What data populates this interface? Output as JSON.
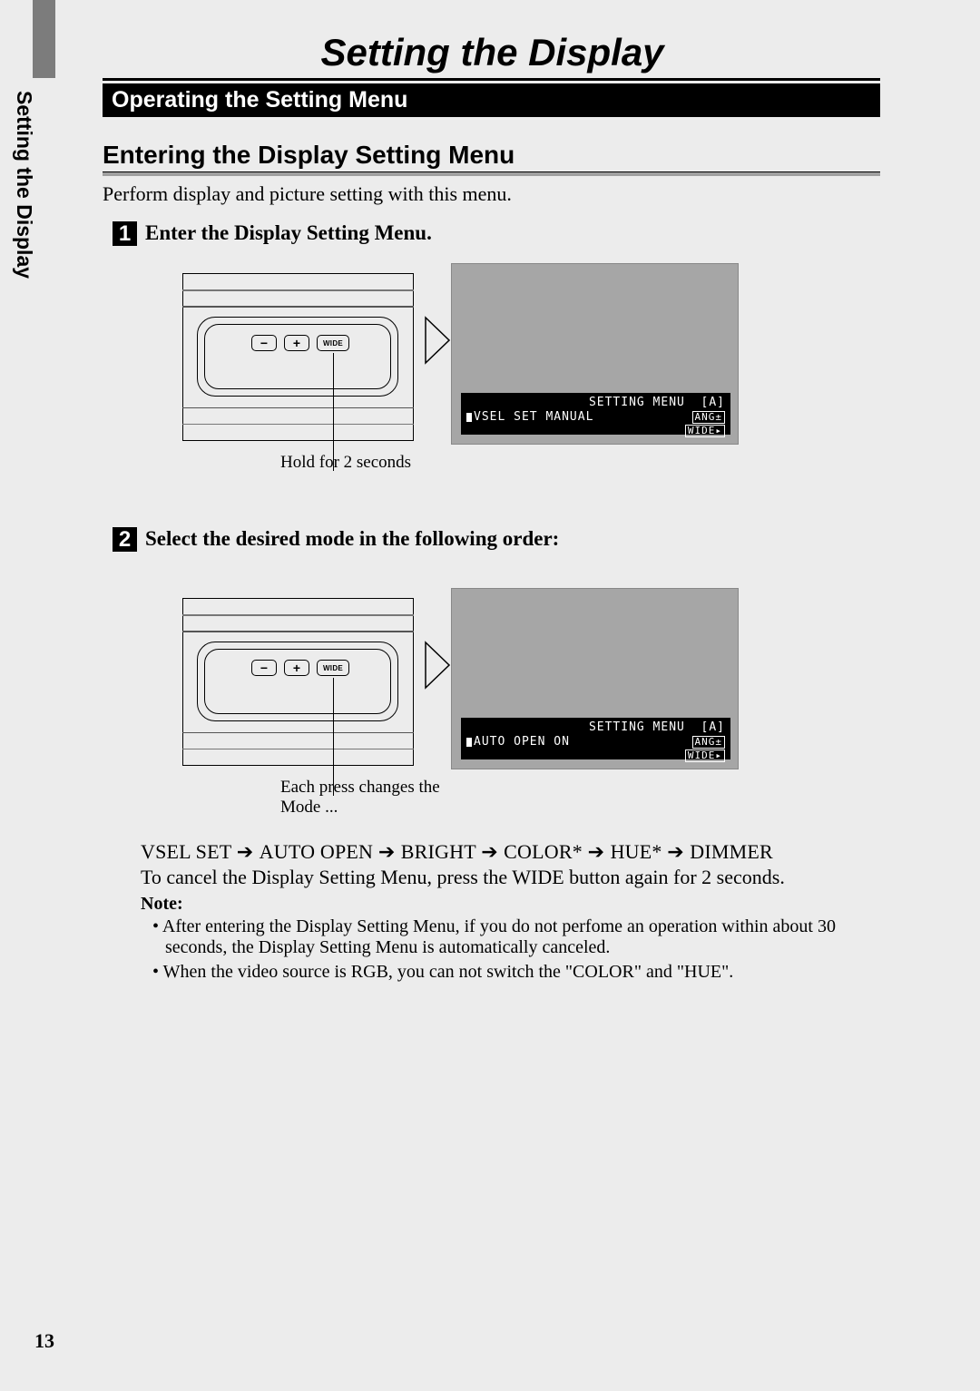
{
  "sideTitle": "Setting the Display",
  "pageTitle": "Setting the Display",
  "blackBar": "Operating the Setting Menu",
  "subHeading": "Entering the Display Setting Menu",
  "intro": "Perform display and picture setting with this menu.",
  "step1": {
    "num": "1",
    "title": "Enter the Display Setting Menu.",
    "wideLabel": "WIDE",
    "caption": "Hold for 2 seconds",
    "lcd": {
      "header": "SETTING MENU",
      "headerR": "[A]",
      "line2L": "VSEL SET MANUAL",
      "ang": "ANG±",
      "wide": "WIDE▸"
    }
  },
  "step2": {
    "num": "2",
    "title": "Select the desired mode in the following order:",
    "wideLabel": "WIDE",
    "caption": "Each press changes the Mode ...",
    "lcd": {
      "header": "SETTING MENU",
      "headerR": "[A]",
      "line2L": "AUTO OPEN ON",
      "ang": "ANG±",
      "wide": "WIDE▸"
    }
  },
  "sequence": {
    "s1": "VSEL SET",
    "s2": "AUTO OPEN",
    "s3": "BRIGHT",
    "s4": "COLOR*",
    "s5": "HUE*",
    "s6": "DIMMER"
  },
  "cancelText": "To cancel the Display Setting Menu, press the WIDE button again for 2 seconds.",
  "noteHeading": "Note:",
  "note1": "After entering the Display Setting Menu, if you do not perfome an operation within about 30 seconds, the Display Setting Menu is automatically canceled.",
  "note2": "When the video source is RGB, you can not switch the \"COLOR\" and \"HUE\".",
  "pageNumber": "13"
}
